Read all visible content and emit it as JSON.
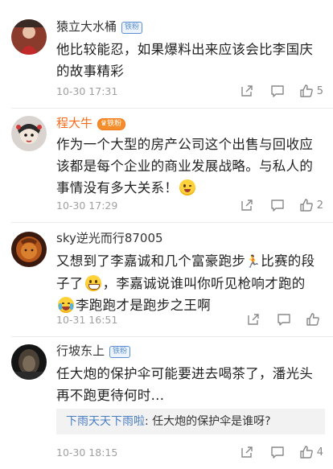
{
  "comments": [
    {
      "username": "猿立大水桶",
      "badge": "铁粉",
      "text": "他比较能忍，如果爆料出来应该会比李国庆的故事精彩",
      "time": "10-30 17:31",
      "likes": "5"
    },
    {
      "username": "程大牛",
      "badge": "铁粉",
      "text": "作为一个大型的房产公司这个出售与回收应该都是每个企业的商业发展战略。与私人的事情没有多大关系！",
      "time": "10-30 17:29",
      "likes": "2"
    },
    {
      "username": "sky逆光而行87005",
      "badge": "",
      "text_part1": "又想到了李嘉诚和几个富豪跑步",
      "text_part2": "比赛的段子了",
      "text_part3": "，李嘉诚说谁叫你听见枪响才跑的",
      "text_part4": "李跑跑才是跑步之王啊",
      "time": "10-31 16:51",
      "likes": ""
    },
    {
      "username": "行坡东上",
      "badge": "铁粉",
      "text": "任大炮的保护伞可能要进去喝茶了，潘光头再不跑更待何时...",
      "reply_name": "下雨天天下雨啦",
      "reply_text": ": 任大炮的保护伞是谁呀?",
      "time": "10-30 18:15",
      "likes": "4"
    }
  ],
  "colors": {
    "vip_name": "#f86b1a",
    "reply_name": "#4a7ec2",
    "badge": "#5b8ed0"
  },
  "icons": [
    "share-icon",
    "comment-icon",
    "thumbs-up-icon"
  ]
}
